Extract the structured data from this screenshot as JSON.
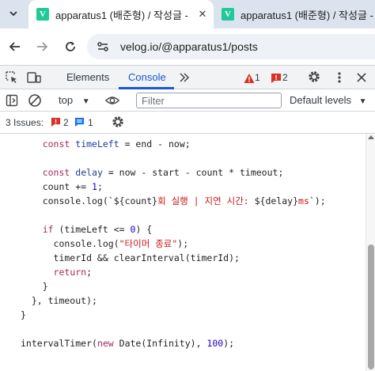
{
  "browser": {
    "tabs": [
      {
        "title": "apparatus1 (배준형) / 작성글 - ",
        "favicon": "V",
        "active": true
      },
      {
        "title": "apparatus1 (배준형) / 작성글 - ",
        "favicon": "V",
        "active": false
      }
    ],
    "url": "velog.io/@apparatus1/posts",
    "favicon_color": "#20c997"
  },
  "devtools": {
    "tabs": {
      "elements": "Elements",
      "console": "Console"
    },
    "errors_count": "1",
    "issues_count": "2",
    "context": "top",
    "filter_placeholder": "Filter",
    "levels": "Default levels",
    "issues_bar": {
      "label": "3 Issues:",
      "error_count": "2",
      "info_count": "1"
    },
    "accent_color": "#1a56d6"
  },
  "code": {
    "lines": [
      [
        {
          "t": "    "
        },
        {
          "t": "const",
          "c": "kw"
        },
        {
          "t": " "
        },
        {
          "t": "timeLeft",
          "c": "vr"
        },
        {
          "t": " = end - now;"
        }
      ],
      [],
      [
        {
          "t": "    "
        },
        {
          "t": "const",
          "c": "kw"
        },
        {
          "t": " "
        },
        {
          "t": "delay",
          "c": "vr"
        },
        {
          "t": " = now - start - count * timeout;"
        }
      ],
      [
        {
          "t": "    count += "
        },
        {
          "t": "1",
          "c": "num"
        },
        {
          "t": ";"
        }
      ],
      [
        {
          "t": "    console.log(`${count}"
        },
        {
          "t": "회 실행 | 지연 시간: ",
          "c": "str"
        },
        {
          "t": "${delay}"
        },
        {
          "t": "ms",
          "c": "str"
        },
        {
          "t": "`);"
        }
      ],
      [],
      [
        {
          "t": "    "
        },
        {
          "t": "if",
          "c": "kw"
        },
        {
          "t": " (timeLeft <= "
        },
        {
          "t": "0",
          "c": "num"
        },
        {
          "t": ") {"
        }
      ],
      [
        {
          "t": "      console.log("
        },
        {
          "t": "\"타이머 종료\"",
          "c": "str"
        },
        {
          "t": ");"
        }
      ],
      [
        {
          "t": "      timerId && clearInterval(timerId);"
        }
      ],
      [
        {
          "t": "      "
        },
        {
          "t": "return",
          "c": "kw"
        },
        {
          "t": ";"
        }
      ],
      [
        {
          "t": "    }"
        }
      ],
      [
        {
          "t": "  }, timeout);"
        }
      ],
      [
        {
          "t": "}"
        }
      ],
      [],
      [
        {
          "t": "intervalTimer("
        },
        {
          "t": "new",
          "c": "kw"
        },
        {
          "t": " Date(Infinity), "
        },
        {
          "t": "100",
          "c": "num"
        },
        {
          "t": ");"
        }
      ]
    ]
  }
}
